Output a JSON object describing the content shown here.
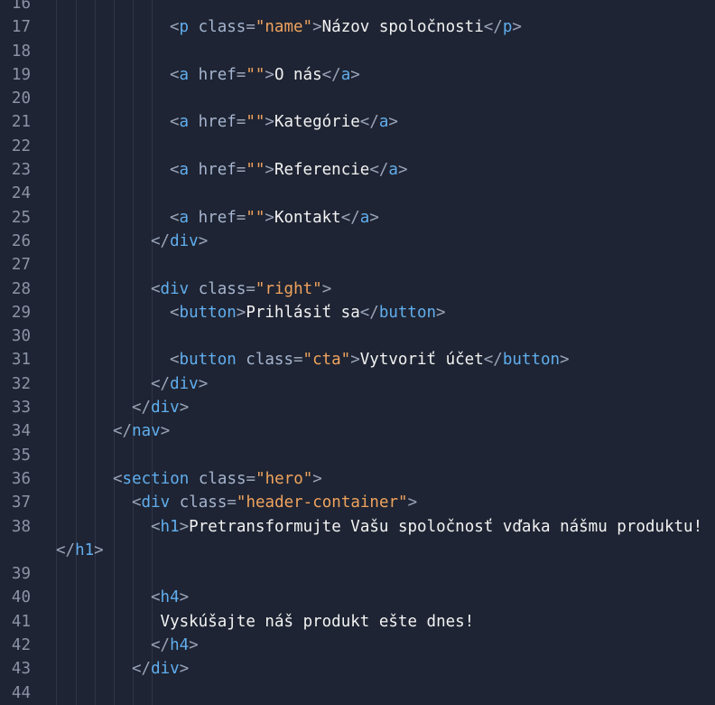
{
  "editor": {
    "lines": [
      {
        "n": "16",
        "indent": 0,
        "tokens": []
      },
      {
        "n": "17",
        "indent": 6,
        "tokens": [
          [
            "p",
            "<"
          ],
          [
            "tn",
            "p"
          ],
          [
            "at",
            " class"
          ],
          [
            "p",
            "="
          ],
          [
            "st",
            "\"name\""
          ],
          [
            "p",
            ">"
          ],
          [
            "tx",
            "Názov spoločnosti"
          ],
          [
            "p",
            "</"
          ],
          [
            "tn",
            "p"
          ],
          [
            "p",
            ">"
          ]
        ]
      },
      {
        "n": "18",
        "indent": 0,
        "tokens": []
      },
      {
        "n": "19",
        "indent": 6,
        "tokens": [
          [
            "p",
            "<"
          ],
          [
            "tn",
            "a"
          ],
          [
            "at",
            " href"
          ],
          [
            "p",
            "="
          ],
          [
            "st",
            "\"\""
          ],
          [
            "p",
            ">"
          ],
          [
            "tx",
            "O nás"
          ],
          [
            "p",
            "</"
          ],
          [
            "tn",
            "a"
          ],
          [
            "p",
            ">"
          ]
        ]
      },
      {
        "n": "20",
        "indent": 0,
        "tokens": []
      },
      {
        "n": "21",
        "indent": 6,
        "tokens": [
          [
            "p",
            "<"
          ],
          [
            "tn",
            "a"
          ],
          [
            "at",
            " href"
          ],
          [
            "p",
            "="
          ],
          [
            "st",
            "\"\""
          ],
          [
            "p",
            ">"
          ],
          [
            "tx",
            "Kategórie"
          ],
          [
            "p",
            "</"
          ],
          [
            "tn",
            "a"
          ],
          [
            "p",
            ">"
          ]
        ]
      },
      {
        "n": "22",
        "indent": 0,
        "tokens": []
      },
      {
        "n": "23",
        "indent": 6,
        "tokens": [
          [
            "p",
            "<"
          ],
          [
            "tn",
            "a"
          ],
          [
            "at",
            " href"
          ],
          [
            "p",
            "="
          ],
          [
            "st",
            "\"\""
          ],
          [
            "p",
            ">"
          ],
          [
            "tx",
            "Referencie"
          ],
          [
            "p",
            "</"
          ],
          [
            "tn",
            "a"
          ],
          [
            "p",
            ">"
          ]
        ]
      },
      {
        "n": "24",
        "indent": 0,
        "tokens": []
      },
      {
        "n": "25",
        "indent": 6,
        "tokens": [
          [
            "p",
            "<"
          ],
          [
            "tn",
            "a"
          ],
          [
            "at",
            " href"
          ],
          [
            "p",
            "="
          ],
          [
            "st",
            "\"\""
          ],
          [
            "p",
            ">"
          ],
          [
            "tx",
            "Kontakt"
          ],
          [
            "p",
            "</"
          ],
          [
            "tn",
            "a"
          ],
          [
            "p",
            ">"
          ]
        ]
      },
      {
        "n": "26",
        "indent": 5,
        "tokens": [
          [
            "p",
            "</"
          ],
          [
            "tn",
            "div"
          ],
          [
            "p",
            ">"
          ]
        ]
      },
      {
        "n": "27",
        "indent": 0,
        "tokens": []
      },
      {
        "n": "28",
        "indent": 5,
        "tokens": [
          [
            "p",
            "<"
          ],
          [
            "tn",
            "div"
          ],
          [
            "at",
            " class"
          ],
          [
            "p",
            "="
          ],
          [
            "st",
            "\"right\""
          ],
          [
            "p",
            ">"
          ]
        ]
      },
      {
        "n": "29",
        "indent": 6,
        "tokens": [
          [
            "p",
            "<"
          ],
          [
            "tn",
            "button"
          ],
          [
            "p",
            ">"
          ],
          [
            "tx",
            "Prihlásiť sa"
          ],
          [
            "p",
            "</"
          ],
          [
            "tn",
            "button"
          ],
          [
            "p",
            ">"
          ]
        ]
      },
      {
        "n": "30",
        "indent": 0,
        "tokens": []
      },
      {
        "n": "31",
        "indent": 6,
        "tokens": [
          [
            "p",
            "<"
          ],
          [
            "tn",
            "button"
          ],
          [
            "at",
            " class"
          ],
          [
            "p",
            "="
          ],
          [
            "st",
            "\"cta\""
          ],
          [
            "p",
            ">"
          ],
          [
            "tx",
            "Vytvoriť účet"
          ],
          [
            "p",
            "</"
          ],
          [
            "tn",
            "button"
          ],
          [
            "p",
            ">"
          ]
        ]
      },
      {
        "n": "32",
        "indent": 5,
        "tokens": [
          [
            "p",
            "</"
          ],
          [
            "tn",
            "div"
          ],
          [
            "p",
            ">"
          ]
        ]
      },
      {
        "n": "33",
        "indent": 4,
        "tokens": [
          [
            "p",
            "</"
          ],
          [
            "tn",
            "div"
          ],
          [
            "p",
            ">"
          ]
        ]
      },
      {
        "n": "34",
        "indent": 3,
        "tokens": [
          [
            "p",
            "</"
          ],
          [
            "tn",
            "nav"
          ],
          [
            "p",
            ">"
          ]
        ]
      },
      {
        "n": "35",
        "indent": 0,
        "tokens": []
      },
      {
        "n": "36",
        "indent": 3,
        "tokens": [
          [
            "p",
            "<"
          ],
          [
            "tn",
            "section"
          ],
          [
            "at",
            " class"
          ],
          [
            "p",
            "="
          ],
          [
            "st",
            "\"hero\""
          ],
          [
            "p",
            ">"
          ]
        ]
      },
      {
        "n": "37",
        "indent": 4,
        "tokens": [
          [
            "p",
            "<"
          ],
          [
            "tn",
            "div"
          ],
          [
            "at",
            " class"
          ],
          [
            "p",
            "="
          ],
          [
            "st",
            "\"header-container\""
          ],
          [
            "p",
            ">"
          ]
        ]
      },
      {
        "n": "38",
        "indent": 5,
        "wrap": true,
        "tokens": [
          [
            "p",
            "<"
          ],
          [
            "tn",
            "h1"
          ],
          [
            "p",
            ">"
          ],
          [
            "tx",
            "Pretransformujte Vašu spoločnosť vďaka nášmu produktu!"
          ]
        ],
        "cont": [
          [
            "p",
            "</"
          ],
          [
            "tn",
            "h1"
          ],
          [
            "p",
            ">"
          ]
        ]
      },
      {
        "n": "39",
        "indent": 0,
        "tokens": []
      },
      {
        "n": "40",
        "indent": 5,
        "tokens": [
          [
            "p",
            "<"
          ],
          [
            "tn",
            "h4"
          ],
          [
            "p",
            ">"
          ]
        ]
      },
      {
        "n": "41",
        "indent": 5,
        "tokens": [
          [
            "tx",
            " Vyskúšajte náš produkt ešte dnes!"
          ]
        ]
      },
      {
        "n": "42",
        "indent": 5,
        "tokens": [
          [
            "p",
            "</"
          ],
          [
            "tn",
            "h4"
          ],
          [
            "p",
            ">"
          ]
        ]
      },
      {
        "n": "43",
        "indent": 4,
        "tokens": [
          [
            "p",
            "</"
          ],
          [
            "tn",
            "div"
          ],
          [
            "p",
            ">"
          ]
        ]
      },
      {
        "n": "44",
        "indent": 0,
        "tokens": []
      }
    ]
  }
}
